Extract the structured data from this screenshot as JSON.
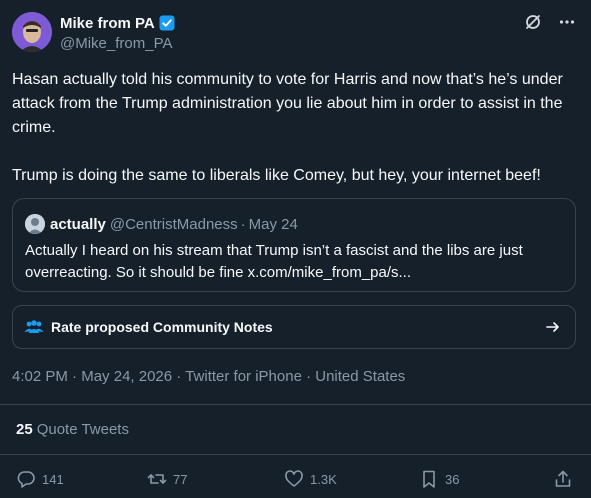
{
  "author": {
    "display_name": "Mike from PA",
    "handle": "@Mike_from_PA",
    "verified": true
  },
  "icons": {
    "verified": "verified-badge-icon",
    "grok": "slash-circle-icon",
    "more": "more-horizontal-icon",
    "community": "people-icon",
    "arrow": "arrow-right-icon",
    "reply": "reply-icon",
    "retweet": "retweet-icon",
    "like": "heart-icon",
    "bookmark": "bookmark-icon",
    "share": "share-icon"
  },
  "tweet": {
    "paragraph_1": "Hasan actually told his community to vote for Harris and now that’s he’s under attack from the Trump administration you lie about him in order to assist in the crime.",
    "paragraph_2": "Trump is doing the same to liberals like Comey, but hey, your internet beef!"
  },
  "quote": {
    "name": "actually",
    "handle": "@CentristMadness",
    "separator": "·",
    "date": "May 24",
    "text": "Actually I heard on his stream that Trump isn’t a fascist and the libs are just overreacting. So it should be fine x.com/mike_from_pa/s..."
  },
  "community_notes": {
    "label": "Rate proposed Community Notes"
  },
  "meta": {
    "time": "4:02 PM",
    "date": "May 24, 2026",
    "source": "Twitter for iPhone",
    "location": "United States"
  },
  "quote_tweets": {
    "count": "25",
    "label": "Quote Tweets"
  },
  "actions": {
    "replies": "141",
    "retweets": "77",
    "likes": "1.3K",
    "bookmarks": "36"
  },
  "colors": {
    "background": "#15202b",
    "text": "#f7f9f9",
    "muted": "#8b98a5",
    "border": "#38444d",
    "verified": "#1d9bf0",
    "community_icon": "#1d9bf0"
  }
}
